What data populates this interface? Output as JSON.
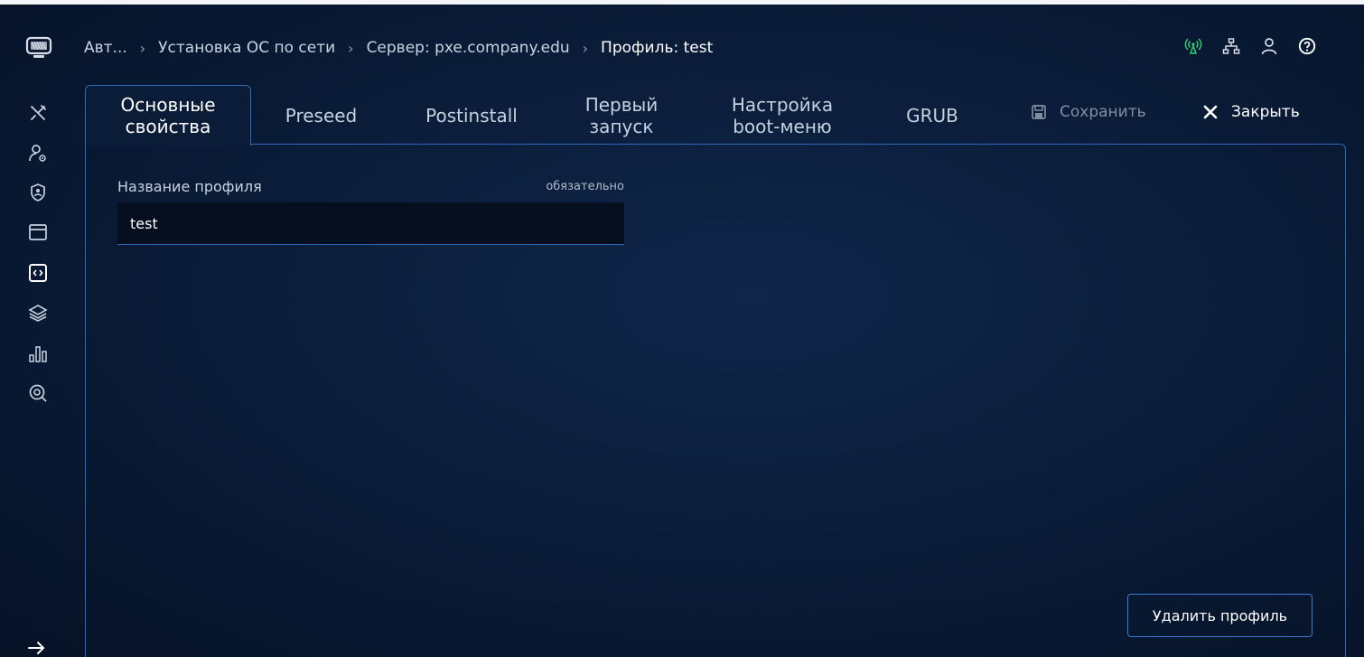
{
  "breadcrumb": {
    "items": [
      "Авт...",
      "Установка ОС по сети",
      "Сервер: pxe.company.edu"
    ],
    "current": "Профиль: test"
  },
  "tabs": [
    {
      "label_line1": "Основные",
      "label_line2": "свойства",
      "active": true
    },
    {
      "label_line1": "Preseed",
      "label_line2": ""
    },
    {
      "label_line1": "Postinstall",
      "label_line2": ""
    },
    {
      "label_line1": "Первый",
      "label_line2": "запуск"
    },
    {
      "label_line1": "Настройка",
      "label_line2": "boot-меню"
    },
    {
      "label_line1": "GRUB",
      "label_line2": ""
    }
  ],
  "actions": {
    "save_label": "Сохранить",
    "close_label": "Закрыть"
  },
  "form": {
    "profile_name_label": "Название профиля",
    "profile_name_required": "обязательно",
    "profile_name_value": "test"
  },
  "delete_button_label": "Удалить профиль",
  "sidebar": {
    "icons": [
      "tools-icon",
      "user-settings-icon",
      "badge-icon",
      "window-icon",
      "code-file-icon",
      "layers-icon",
      "bar-chart-icon",
      "search-refresh-icon"
    ]
  },
  "header_icons": [
    "network-status-icon",
    "network-tree-icon",
    "user-icon",
    "help-icon"
  ],
  "colors": {
    "accent": "#2f6ab8",
    "status_green": "#2ecc71",
    "background": "#0b1d3a"
  }
}
